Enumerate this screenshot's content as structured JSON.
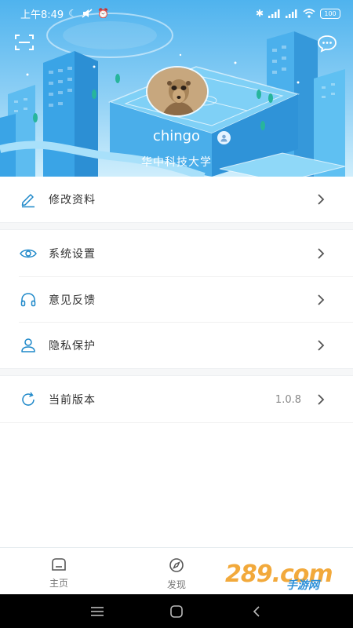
{
  "status_bar": {
    "time": "上午8:49",
    "battery": "100"
  },
  "header": {
    "scan_icon": "scan-icon",
    "message_icon": "chat-bubble-icon"
  },
  "profile": {
    "username": "chingo",
    "school": "华中科技大学",
    "avatar": "meerkat-photo"
  },
  "menu": {
    "items": [
      {
        "label": "修改资料",
        "icon": "edit-pencil-icon"
      },
      {
        "label": "系统设置",
        "icon": "eye-icon"
      },
      {
        "label": "意见反馈",
        "icon": "headset-icon"
      },
      {
        "label": "隐私保护",
        "icon": "user-icon"
      },
      {
        "label": "当前版本",
        "icon": "refresh-icon",
        "value": "1.0.8"
      }
    ]
  },
  "tabbar": {
    "tabs": [
      {
        "label": "主页",
        "icon": "home-icon"
      },
      {
        "label": "发现",
        "icon": "compass-icon"
      }
    ]
  },
  "watermark": {
    "text": "289.com",
    "sub": "手游网"
  },
  "colors": {
    "accent": "#1e88c9",
    "hero_top": "#4fb3ee",
    "hero_bottom": "#cfeefc"
  }
}
